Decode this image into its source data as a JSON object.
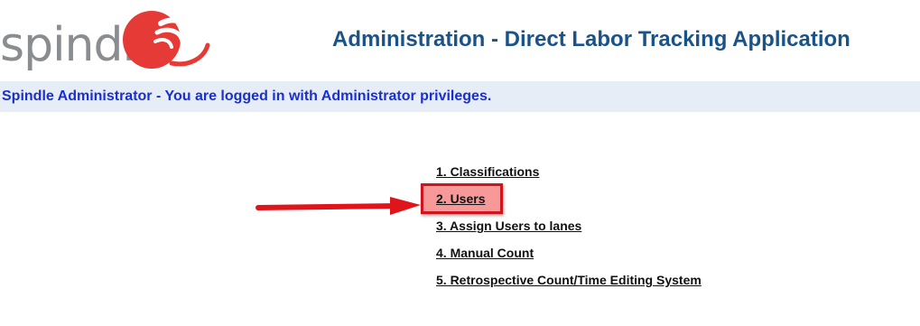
{
  "brand": {
    "logo_text": "spindle",
    "logo_color": "#8a8d90",
    "logo_mark_color": "#e53a35"
  },
  "header": {
    "title": "Administration - Direct Labor Tracking Application"
  },
  "status": {
    "message": "Spindle Administrator - You are logged in with Administrator privileges."
  },
  "menu": {
    "items": [
      {
        "label": "1. Classifications"
      },
      {
        "label": "2. Users"
      },
      {
        "label": "3. Assign Users to lanes"
      },
      {
        "label": "4. Manual Count"
      },
      {
        "label": "5. Retrospective Count/Time Editing System"
      }
    ]
  },
  "annotation": {
    "highlight_color": "#d0141b",
    "arrow_color": "#e0141b"
  }
}
